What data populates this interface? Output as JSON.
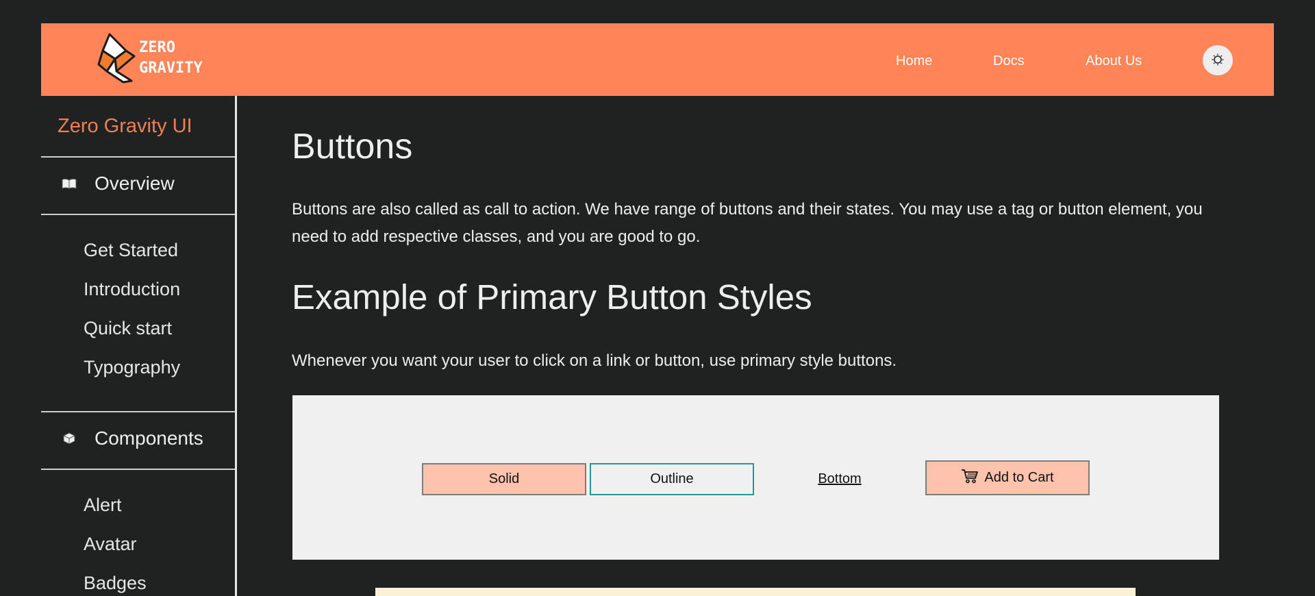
{
  "navbar": {
    "logo_line1": "ZERO",
    "logo_line2": "GRAVITY",
    "links": [
      "Home",
      "Docs",
      "About Us"
    ],
    "theme_icon": "sun-icon",
    "accent": "#ff8558"
  },
  "sidebar": {
    "brand": "Zero Gravity UI",
    "sections": [
      {
        "label": "Overview",
        "icon": "book-icon",
        "items": [
          "Get Started",
          "Introduction",
          "Quick start",
          "Typography"
        ]
      },
      {
        "label": "Components",
        "icon": "cube-icon",
        "items": [
          "Alert",
          "Avatar",
          "Badges"
        ]
      }
    ]
  },
  "main": {
    "title": "Buttons",
    "intro": "Buttons are also called as call to action. We have range of buttons and their states. You may use a tag or button element, you need to add respective classes, and you are good to go.",
    "section_title": "Example of Primary Button Styles",
    "section_desc": "Whenever you want your user to click on a link or button, use primary style buttons.",
    "buttons": {
      "solid": "Solid",
      "outline": "Outline",
      "link": "Bottom",
      "cart": "Add to Cart",
      "cart_icon": "cart-icon"
    }
  }
}
